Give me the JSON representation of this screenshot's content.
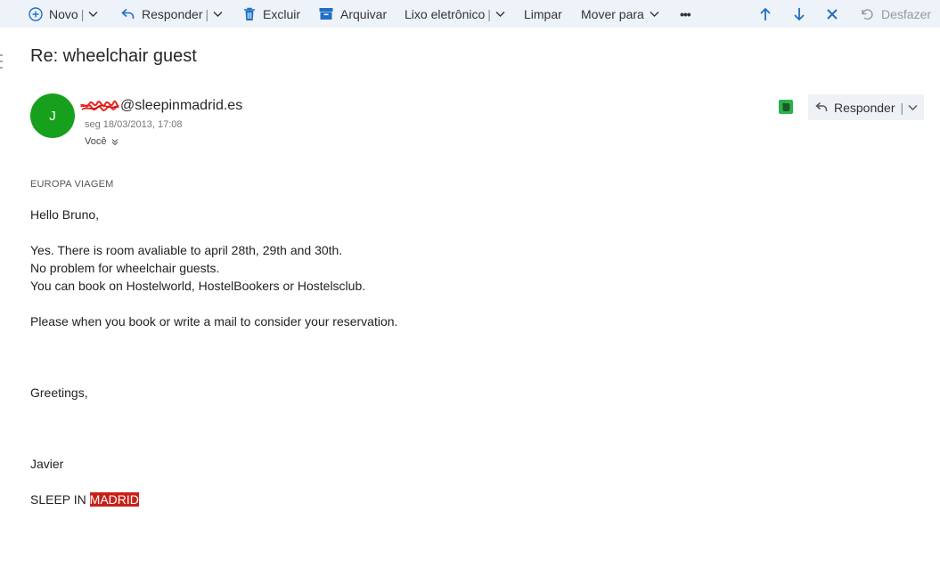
{
  "toolbar": {
    "new_label": "Novo",
    "reply_label": "Responder",
    "delete_label": "Excluir",
    "archive_label": "Arquivar",
    "junk_label": "Lixo eletrônico",
    "sweep_label": "Limpar",
    "move_label": "Mover para",
    "more_label": "•••",
    "undo_label": "Desfazer",
    "sep": "|"
  },
  "message": {
    "subject": "Re: wheelchair guest",
    "avatar_initial": "J",
    "sender_domain": "@sleepinmadrid.es",
    "date": "seg 18/03/2013, 17:08",
    "to": "Você",
    "reply_button_label": "Responder",
    "category": "EUROPA VIAGEM",
    "body": {
      "greeting": "Hello Bruno,",
      "line1": "Yes. There is room avaliable to april 28th, 29th and 30th.",
      "line2": "No problem for wheelchair guests.",
      "line3": "You can book on Hostelworld, HostelBookers or Hostelsclub.",
      "line4": "Please when you book or write a mail to consider your reservation.",
      "closing": "Greetings,",
      "signature_name": "Javier",
      "signature_company_prefix": "SLEEP IN ",
      "signature_company_highlight": "MADRID"
    }
  },
  "colors": {
    "toolbar_bg": "#eef3fa",
    "accent_blue": "#0f6cbd",
    "avatar_green": "#16a01c",
    "highlight_red": "#c7221a"
  }
}
